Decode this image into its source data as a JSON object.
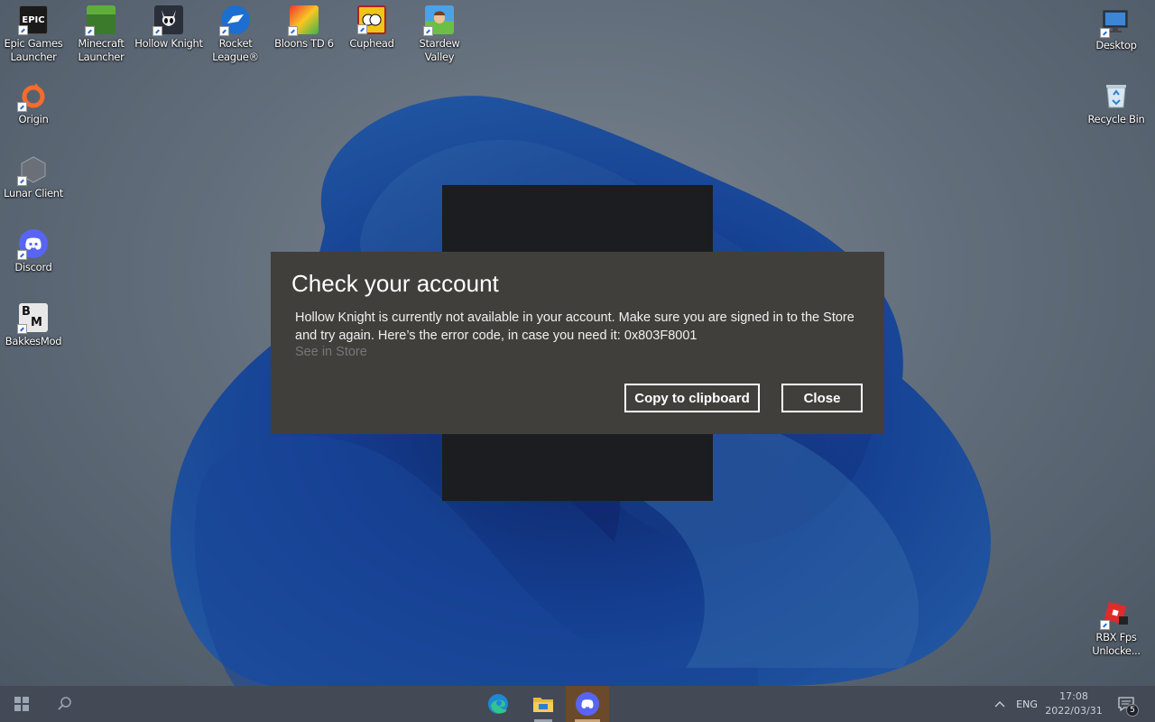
{
  "desktop_icons_left": [
    {
      "label": "Epic Games Launcher",
      "icon": "epic-games-icon"
    },
    {
      "label": "Minecraft Launcher",
      "icon": "minecraft-icon"
    },
    {
      "label": "Hollow Knight",
      "icon": "hollow-knight-icon"
    },
    {
      "label": "Rocket League®",
      "icon": "rocket-league-icon"
    },
    {
      "label": "Bloons TD 6",
      "icon": "bloons-td6-icon"
    },
    {
      "label": "Cuphead",
      "icon": "cuphead-icon"
    },
    {
      "label": "Stardew Valley",
      "icon": "stardew-valley-icon"
    },
    {
      "label": "Origin",
      "icon": "origin-icon"
    },
    {
      "label": "Lunar Client",
      "icon": "lunar-client-icon"
    },
    {
      "label": "Discord",
      "icon": "discord-icon"
    },
    {
      "label": "BakkesMod",
      "icon": "bakkesmod-icon"
    }
  ],
  "desktop_icons_right": [
    {
      "label": "Desktop",
      "icon": "desktop-icon"
    },
    {
      "label": "Recycle Bin",
      "icon": "recycle-bin-icon"
    },
    {
      "label": "RBX Fps Unlocke...",
      "icon": "rbx-fps-unlocker-icon"
    }
  ],
  "dialog": {
    "title": "Check your account",
    "message": "Hollow Knight is currently not available in your account. Make sure you are signed in to the Store and try again. Here’s the error code, in case you need it: 0x803F8001",
    "link": "See in Store",
    "copy_button": "Copy to clipboard",
    "close_button": "Close"
  },
  "taskbar": {
    "start": "windows-start-icon",
    "search": "search-icon",
    "pinned": [
      "edge-icon",
      "file-explorer-icon",
      "discord-icon"
    ],
    "tray_chevron": "chevron-up-icon",
    "language": "ENG",
    "time": "17:08",
    "date": "2022/03/31",
    "notifications_count": "5"
  },
  "colors": {
    "dialog_bg": "#403f3b",
    "taskbar_bg": "#434a55",
    "discord": "#5865f2"
  }
}
